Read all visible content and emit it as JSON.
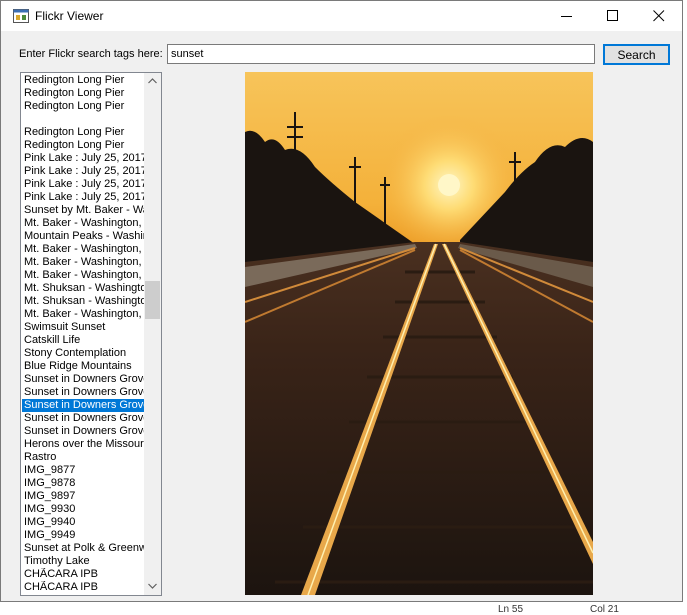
{
  "window": {
    "title": "Flickr Viewer"
  },
  "search": {
    "label": "Enter Flickr search tags here:",
    "value": "sunset",
    "button_label": "Search"
  },
  "results": {
    "items": [
      "Redington Long Pier",
      "Redington Long Pier",
      "Redington Long Pier",
      "",
      "Redington Long Pier",
      "Redington Long Pier",
      "Pink Lake : July 25, 2017",
      "Pink Lake : July 25, 2017",
      "Pink Lake : July 25, 2017",
      "Pink Lake : July 25, 2017",
      "Sunset by Mt. Baker - Wa",
      "Mt. Baker - Washington,",
      "Mountain Peaks - Washin",
      "Mt. Baker - Washington,",
      "Mt. Baker - Washington,",
      "Mt. Baker - Washington,",
      "Mt. Shuksan - Washingto",
      "Mt. Shuksan - Washingto",
      "Mt. Baker - Washington,",
      "Swimsuit Sunset",
      "Catskill Life",
      "Stony Contemplation",
      "Blue Ridge Mountains",
      "Sunset in Downers Grove",
      "Sunset in Downers Grove",
      "Sunset in Downers Grove",
      "Sunset in Downers Grove",
      "Sunset in Downers Grove",
      "Herons over the Missouri",
      "Rastro",
      "IMG_9877",
      "IMG_9878",
      "IMG_9897",
      "IMG_9930",
      "IMG_9940",
      "IMG_9949",
      "Sunset at Polk & Greenwi",
      "Timothy Lake",
      "CHÃCARA IPB",
      "CHÃCARA IPB"
    ],
    "selected_index": 25
  },
  "status": {
    "left": "Ln 55",
    "right": "Col 21"
  },
  "colors": {
    "selection": "#0078d7",
    "sky_top": "#f7c45a",
    "sun": "#fff7c8"
  }
}
